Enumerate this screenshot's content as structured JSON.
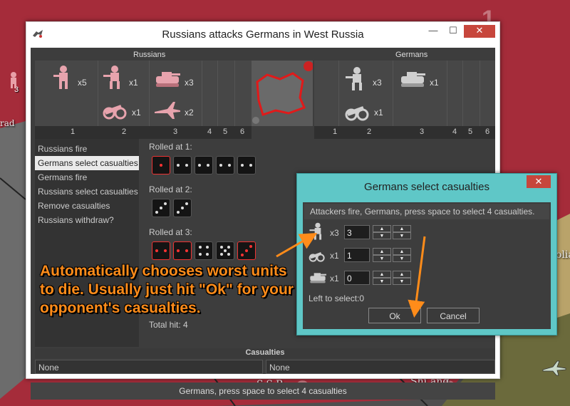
{
  "window": {
    "title": "Russians attacks Germans in West Russia",
    "minimize": "—",
    "maximize": "☐",
    "close": "✕"
  },
  "attacker": {
    "name": "Russians",
    "units": [
      {
        "icon": "infantry-icon",
        "count": "x5"
      },
      {
        "icon": "infantry-icon",
        "count": "x1"
      },
      {
        "icon": "artillery-icon",
        "count": "x1"
      },
      {
        "icon": "tank-icon",
        "count": "x3"
      },
      {
        "icon": "fighter-icon",
        "count": "x2"
      }
    ],
    "columns": [
      "1",
      "2",
      "3",
      "4",
      "5",
      "6"
    ]
  },
  "defender": {
    "name": "Germans",
    "units": [
      {
        "icon": "infantry-icon",
        "count": "x3"
      },
      {
        "icon": "artillery-icon",
        "count": "x1"
      },
      {
        "icon": "tank-icon",
        "count": "x1"
      }
    ],
    "columns": [
      "1",
      "2",
      "3",
      "4",
      "5",
      "6"
    ]
  },
  "steps": [
    {
      "label": "Russians fire",
      "selected": false
    },
    {
      "label": "Germans select casualties",
      "selected": true
    },
    {
      "label": "Germans fire",
      "selected": false
    },
    {
      "label": "Russians select casualties",
      "selected": false
    },
    {
      "label": "Remove casualties",
      "selected": false
    },
    {
      "label": "Russians withdraw?",
      "selected": false
    }
  ],
  "rolls": [
    {
      "label": "Rolled at 1:",
      "dice": [
        {
          "value": 1,
          "hit": true
        },
        {
          "value": 2,
          "hit": false
        },
        {
          "value": 2,
          "hit": false
        },
        {
          "value": 2,
          "hit": false
        },
        {
          "value": 2,
          "hit": false
        }
      ]
    },
    {
      "label": "Rolled at 2:",
      "dice": [
        {
          "value": 3,
          "hit": false
        },
        {
          "value": 3,
          "hit": false
        }
      ]
    },
    {
      "label": "Rolled at 3:",
      "dice": [
        {
          "value": 2,
          "hit": true
        },
        {
          "value": 2,
          "hit": true
        },
        {
          "value": 4,
          "hit": false
        },
        {
          "value": 5,
          "hit": false
        },
        {
          "value": 3,
          "hit": true
        }
      ]
    }
  ],
  "total_hit": "Total hit: 4",
  "casualties": {
    "header": "Casualties",
    "left": "None",
    "right": "None"
  },
  "status_bar": "Germans, press space to select 4 casualties",
  "dialog": {
    "title": "Germans select casualties",
    "close": "✕",
    "message": "Attackers fire, Germans, press space to select 4 casualties.",
    "rows": [
      {
        "icon": "infantry-icon",
        "count": "x3",
        "value": "3"
      },
      {
        "icon": "artillery-icon",
        "count": "x1",
        "value": "1"
      },
      {
        "icon": "tank-icon",
        "count": "x1",
        "value": "0"
      }
    ],
    "left_to_select": "Left to select:0",
    "ok": "Ok",
    "cancel": "Cancel"
  },
  "annotation": "Automatically chooses worst units to die. Usually just hit \"Ok\" for your opponent's casualties.",
  "map": {
    "labels": [
      "S.S.R.",
      "Shi",
      "ang",
      "rad",
      "olia"
    ],
    "numbers": [
      "1",
      "2",
      "2",
      "3",
      "4"
    ]
  },
  "colors": {
    "soviet": "#a52c3a",
    "german": "#6a6a4a",
    "accent": "#ff8c1a",
    "dialog_frame": "#5fc7c7"
  }
}
